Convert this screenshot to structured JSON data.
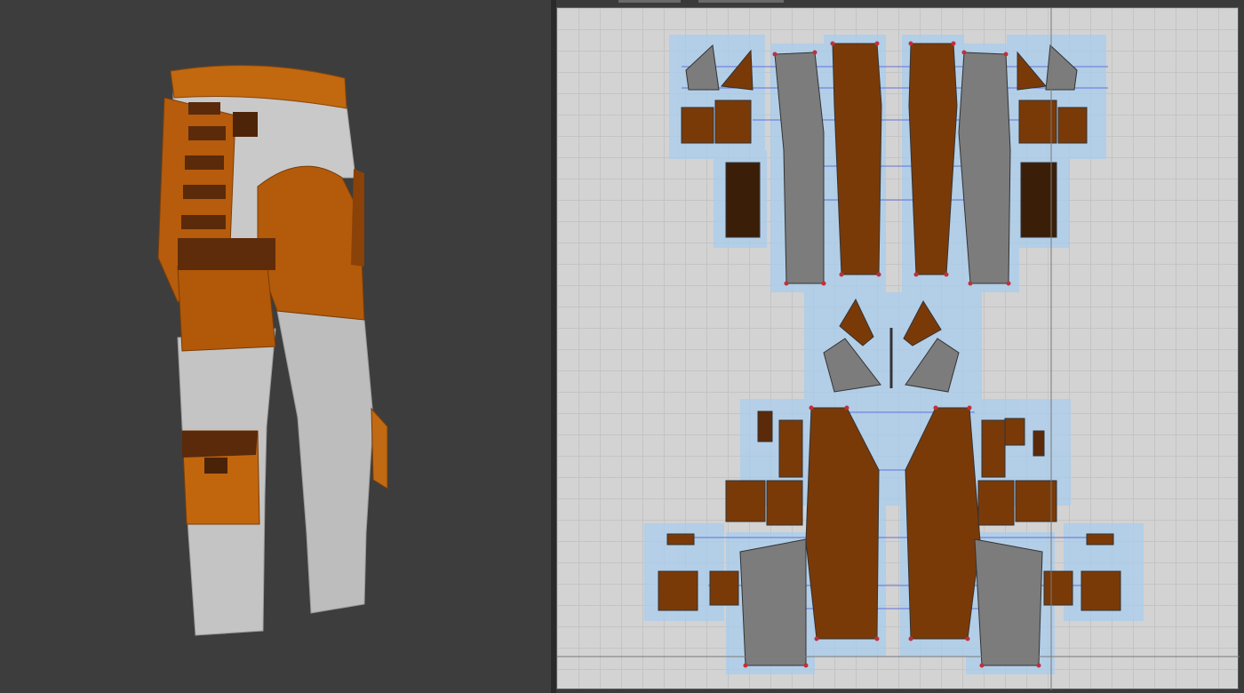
{
  "colors": {
    "fabric_orange": "#b45a0b",
    "fabric_orange_light": "#d07a1c",
    "fabric_grey": "#c8c8c8",
    "fabric_dark_brown": "#5a2a0a",
    "pattern_orange": "#7a3a08",
    "pattern_grey": "#7c7c7c",
    "pattern_dark": "#3a1e08",
    "selection_blue": "#a9cdee",
    "seam_line": "#4b5bd8",
    "point_red": "#c0303a",
    "canvas_bg": "#d3d3d3"
  },
  "viewport_3d": {
    "icon": "pants-3d-avatar"
  },
  "pattern_window": {
    "icon": "pattern-2d-layout"
  }
}
